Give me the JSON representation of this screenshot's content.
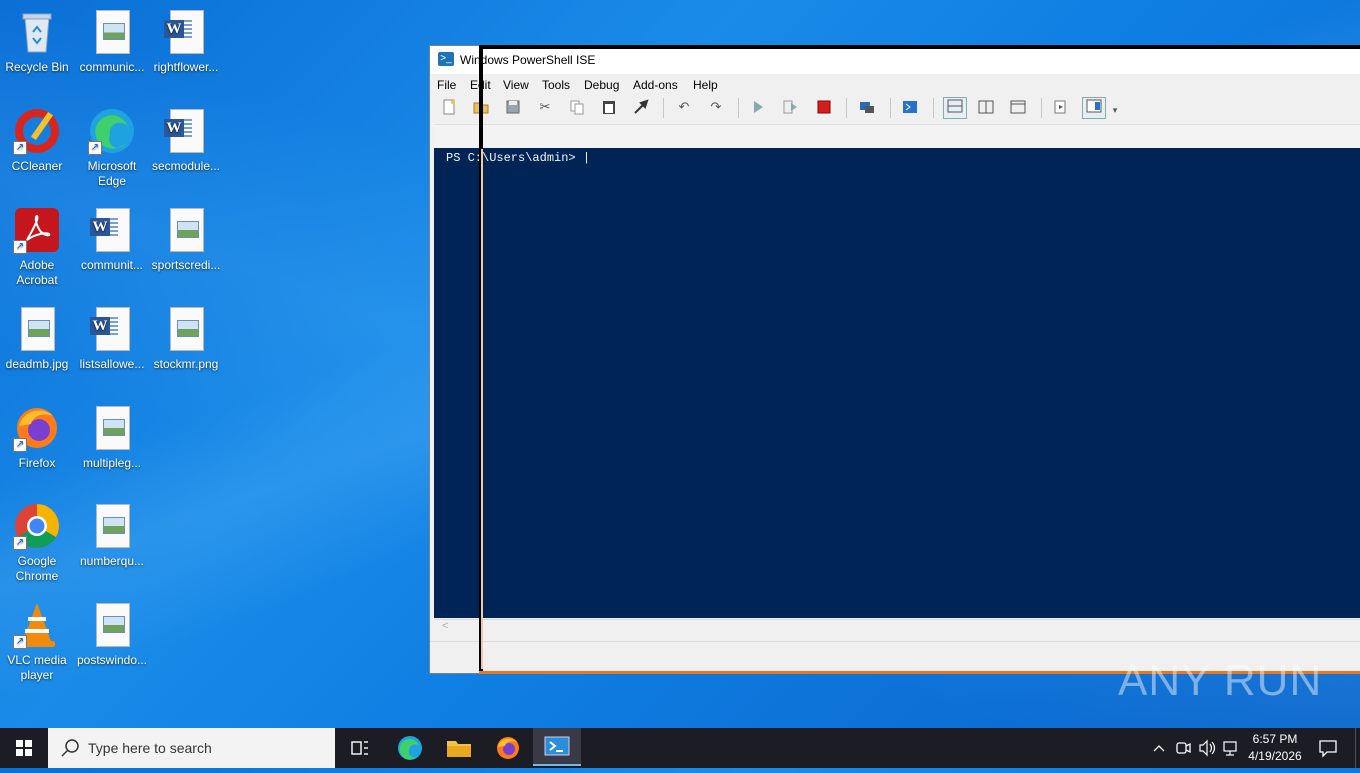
{
  "desktop": {
    "icons": [
      {
        "label": "Recycle Bin"
      },
      {
        "label": "communic..."
      },
      {
        "label": "rightflower..."
      },
      {
        "label": "CCleaner"
      },
      {
        "label": "Microsoft Edge"
      },
      {
        "label": "secmodule..."
      },
      {
        "label": "Adobe Acrobat"
      },
      {
        "label": "communit..."
      },
      {
        "label": "sportscredi..."
      },
      {
        "label": "deadmb.jpg"
      },
      {
        "label": "listsallowe..."
      },
      {
        "label": "stockmr.png"
      },
      {
        "label": "Firefox"
      },
      {
        "label": "multipleg..."
      },
      {
        "label": "Google Chrome"
      },
      {
        "label": "numberqu..."
      },
      {
        "label": "VLC media player"
      },
      {
        "label": "postswindo..."
      }
    ]
  },
  "window": {
    "title": "Windows PowerShell ISE",
    "menu": [
      "File",
      "Edit",
      "View",
      "Tools",
      "Debug",
      "Add-ons",
      "Help"
    ],
    "console_prompt": "PS C:\\Users\\admin> |",
    "scroll_arrow": "<"
  },
  "watermark": "ANY RUN",
  "taskbar": {
    "search_placeholder": "Type here to search",
    "time": "6:57 PM",
    "date": "4/19/2026"
  },
  "colors": {
    "console_bg": "#012456",
    "desktop_bg": "#0f7ee3",
    "taskbar_bg": "#1c1c24"
  }
}
